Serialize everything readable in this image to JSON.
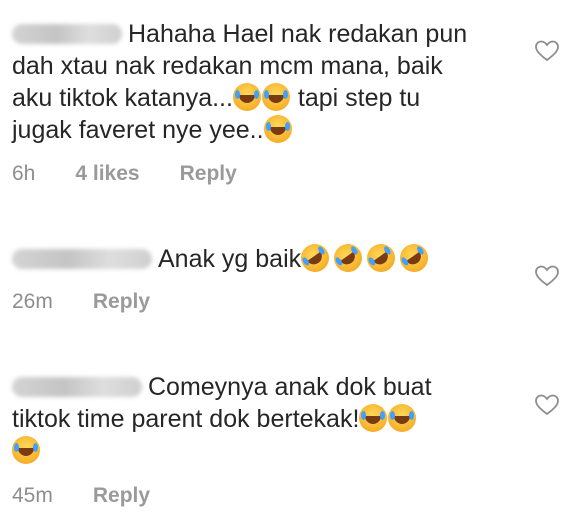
{
  "comments": [
    {
      "text_lines": [
        "Hahaha Hael nak redakan pun",
        "dah xtau nak redakan mcm mana, baik",
        "aku tiktok katanya...",
        " tapi step tu",
        "jugak faveret nye yee.."
      ],
      "time": "6h",
      "likes": "4 likes",
      "reply": "Reply"
    },
    {
      "text": "Anak yg baik",
      "time": "26m",
      "reply": "Reply"
    },
    {
      "text_lines": [
        "Comeynya anak dok buat",
        "tiktok time parent dok bertekak!"
      ],
      "time": "45m",
      "reply": "Reply"
    }
  ],
  "icons": {
    "like": "heart-outline-icon",
    "emoji_laugh": "face-with-tears-of-joy",
    "emoji_rofl": "rolling-on-floor-laughing"
  }
}
